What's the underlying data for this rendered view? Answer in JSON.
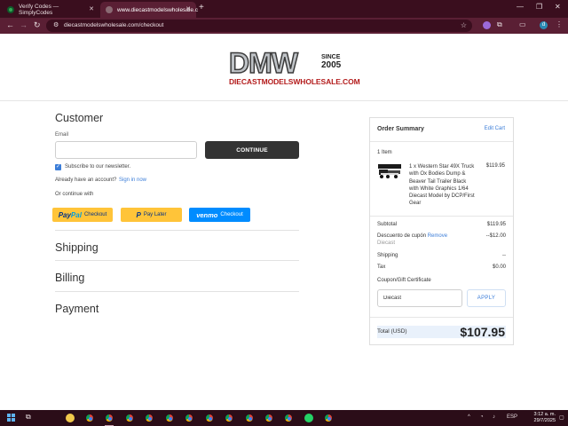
{
  "browser": {
    "tabs": [
      {
        "title": "Verify Codes — SimplyCodes",
        "active": false
      },
      {
        "title": "www.diecastmodelswholesale.c",
        "active": true
      }
    ],
    "url": "diecastmodelswholesale.com/checkout",
    "profile_initial": "d",
    "colors": {
      "frame": "#3a0e1e",
      "toolbar": "#5a1f34"
    }
  },
  "logo": {
    "main": "DMW",
    "since": "SINCE",
    "year": "2005",
    "domain": "DIECASTMODELSWHOLESALE.COM"
  },
  "customer": {
    "title": "Customer",
    "email_label": "Email",
    "email_value": "",
    "continue_label": "CONTINUE",
    "newsletter_label": "Subscribe to our newsletter.",
    "newsletter_checked": true,
    "account_text": "Already have an account?",
    "signin_link": "Sign in now",
    "or_text": "Or continue with"
  },
  "payment_buttons": {
    "paypal": {
      "brand_a": "Pay",
      "brand_b": "Pal",
      "label": "Checkout"
    },
    "paylater": {
      "label": "Pay Later"
    },
    "venmo": {
      "brand": "venmo",
      "label": "Checkout"
    }
  },
  "sections": {
    "shipping": "Shipping",
    "billing": "Billing",
    "payment": "Payment"
  },
  "summary": {
    "title": "Order Summary",
    "edit_cart": "Edit Cart",
    "item_count": "1 Item",
    "product": {
      "name": "1 x Western Star 49X Truck with Ox Bodies Dump & Beaver Tail Trailer Black with White Graphics 1/64 Diecast Model by DCP/First Gear",
      "price": "$119.95"
    },
    "subtotal_label": "Subtotal",
    "subtotal_value": "$119.95",
    "coupon_label": "Descuento de cupón",
    "coupon_remove": "Remove",
    "coupon_code": "Diecast",
    "coupon_value": "--$12.00",
    "shipping_label": "Shipping",
    "shipping_value": "--",
    "tax_label": "Tax",
    "tax_value": "$0.00",
    "gift_label": "Coupon/Gift Certificate",
    "gift_input": "Diecast",
    "apply_label": "APPLY",
    "total_label": "Total (USD)",
    "total_value": "$107.95",
    "total_highlight": "#e9f1fb"
  },
  "taskbar": {
    "language": "ESP",
    "time": "3:12 a. m.",
    "date": "29/7/2025"
  }
}
